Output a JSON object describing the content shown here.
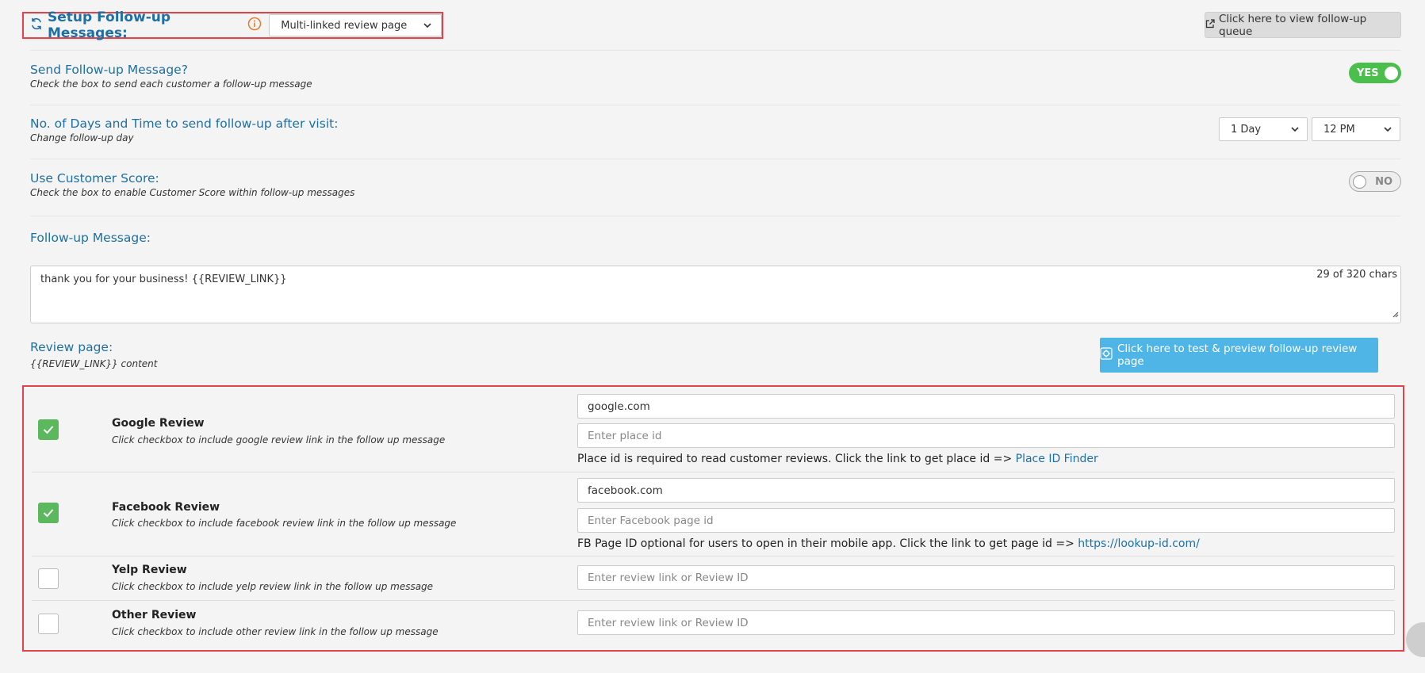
{
  "header": {
    "title": "Setup Follow-up Messages:",
    "template_value": "Multi-linked review page",
    "queue_button": "Click here to view follow-up queue"
  },
  "send_followup": {
    "title": "Send Follow-up Message?",
    "subtitle": "Check the box to send each customer a follow-up message",
    "toggle_label": "YES"
  },
  "days_time": {
    "title": "No. of Days and Time to send follow-up after visit:",
    "subtitle": "Change follow-up day",
    "day_value": "1 Day",
    "time_value": "12 PM"
  },
  "customer_score": {
    "title": "Use Customer Score:",
    "subtitle": "Check the box to enable Customer Score within follow-up messages",
    "toggle_label": "NO"
  },
  "followup_message": {
    "title": "Follow-up Message:",
    "text": "thank you for your business!  {{REVIEW_LINK}}",
    "char_count": "29 of 320 chars"
  },
  "review_page": {
    "title": "Review page:",
    "subtitle": "{{REVIEW_LINK}} content",
    "preview_button": "Click here to test & preview follow-up review page"
  },
  "reviews": [
    {
      "title": "Google Review",
      "subtitle": "Click checkbox to include google review link in the follow up message",
      "checked": true,
      "link_value": "google.com",
      "id_placeholder": "Enter place id",
      "help_text": "Place id is required to read customer reviews. Click the link to get place id => ",
      "help_link": "Place ID Finder"
    },
    {
      "title": "Facebook Review",
      "subtitle": "Click checkbox to include facebook review link in the follow up message",
      "checked": true,
      "link_value": "facebook.com",
      "id_placeholder": "Enter Facebook page id",
      "help_text": "FB Page ID optional for users to open in their mobile app. Click the link to get page id => ",
      "help_link": "https://lookup-id.com/"
    },
    {
      "title": "Yelp Review",
      "subtitle": "Click checkbox to include yelp review link in the follow up message",
      "checked": false,
      "link_placeholder": "Enter review link or Review ID"
    },
    {
      "title": "Other Review",
      "subtitle": "Click checkbox to include other review link in the follow up message",
      "checked": false,
      "link_placeholder": "Enter review link or Review ID"
    }
  ],
  "colors": {
    "accent_blue": "#1d6fa5",
    "highlight_red": "#e0454d",
    "toggle_green": "#4bbf4b",
    "check_green": "#5cb85c",
    "preview_button_blue": "#4eb5e6",
    "info_orange": "#e8792d"
  }
}
